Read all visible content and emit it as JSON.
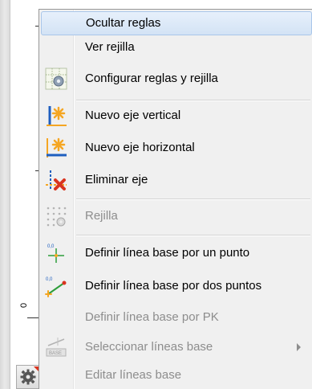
{
  "background": {
    "ruler_zero_label": "0"
  },
  "menu": {
    "items": [
      {
        "label": "Ocultar reglas",
        "enabled": true,
        "highlighted": true,
        "icon": "none"
      },
      {
        "label": "Ver rejilla",
        "enabled": true,
        "icon": "none"
      },
      {
        "label": "Configurar reglas y rejilla",
        "enabled": true,
        "icon": "configure-grid-icon"
      },
      {
        "label": "Nuevo eje vertical",
        "enabled": true,
        "icon": "new-vertical-axis-icon"
      },
      {
        "label": "Nuevo eje horizontal",
        "enabled": true,
        "icon": "new-horizontal-axis-icon"
      },
      {
        "label": "Eliminar eje",
        "enabled": true,
        "icon": "delete-axis-icon"
      },
      {
        "label": "Rejilla",
        "enabled": false,
        "icon": "grid-icon"
      },
      {
        "label": "Definir línea base por un punto",
        "enabled": true,
        "icon": "baseline-one-point-icon"
      },
      {
        "label": "Definir línea base por dos puntos",
        "enabled": true,
        "icon": "baseline-two-points-icon"
      },
      {
        "label": "Definir línea base por PK",
        "enabled": false,
        "icon": "none"
      },
      {
        "label": "Seleccionar líneas base",
        "enabled": false,
        "has_submenu": true,
        "icon": "select-baselines-icon",
        "icon_text": "BASE"
      },
      {
        "label": "Editar líneas base",
        "enabled": false,
        "icon": "none"
      }
    ]
  },
  "colors": {
    "highlight_top": "#e7f0fb",
    "highlight_bottom": "#d3e3f5",
    "menu_bg": "#f0f0f0",
    "disabled_text": "#8d8d8d",
    "accent_orange": "#f5a623",
    "accent_blue": "#1f5fbf",
    "accent_red": "#d9341f",
    "accent_green": "#2e9e3a"
  }
}
